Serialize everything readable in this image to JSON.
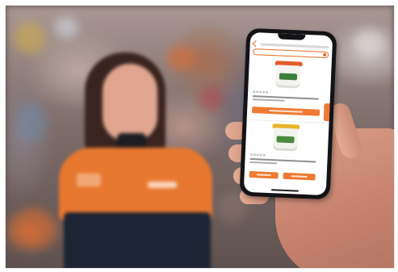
{
  "scene": {
    "description_tags": [
      "store-background",
      "employee",
      "hand",
      "smartphone"
    ],
    "colors": {
      "brand_orange": "#ee7a33",
      "uniform_orange": "#e8782f",
      "uniform_navy": "#1d2433",
      "phone_frame": "#131316"
    }
  },
  "phone": {
    "status_bar": {
      "time": "",
      "battery": ""
    },
    "products": [
      {
        "rating_stars": 5,
        "lid_color": "#e45a2a",
        "label_color": "#3b7f3a",
        "has_add_button": true
      },
      {
        "rating_stars": 5,
        "lid_color": "#e8b52b",
        "label_color": "#4a8a3f",
        "has_add_button": false
      }
    ],
    "bottom_buttons": 2
  }
}
